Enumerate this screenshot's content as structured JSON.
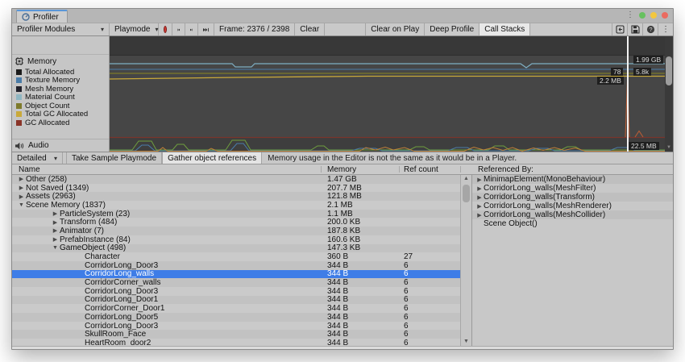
{
  "tab": {
    "title": "Profiler"
  },
  "window_controls": {
    "colors": [
      "#67c15f",
      "#f3c73f",
      "#ea6b60"
    ]
  },
  "toolbar": {
    "modules_dropdown": "Profiler Modules",
    "playmode_dropdown": "Playmode",
    "frame_label": "Frame: 2376 / 2398",
    "clear": "Clear",
    "clear_on_play": "Clear on Play",
    "deep_profile": "Deep Profile",
    "call_stacks": "Call Stacks"
  },
  "sidebar": {
    "memory_module": {
      "label": "Memory",
      "legend": [
        {
          "label": "Total Allocated",
          "color": "#1b1b1b"
        },
        {
          "label": "Texture Memory",
          "color": "#4a7ca8"
        },
        {
          "label": "Mesh Memory",
          "color": "#20202a"
        },
        {
          "label": "Material Count",
          "color": "#8fb6c2"
        },
        {
          "label": "Object Count",
          "color": "#7e7a2b"
        },
        {
          "label": "Total GC Allocated",
          "color": "#c9a93a"
        },
        {
          "label": "GC Allocated",
          "color": "#8a3428"
        }
      ]
    },
    "audio_module": {
      "label": "Audio"
    }
  },
  "chart": {
    "labels": {
      "total_allocated": "1.99 GB",
      "object_count": "78",
      "material_count": "5.8k",
      "gc_allocated": "2.2 MB",
      "audio_bottom": "22.5 MB"
    },
    "line_colors": {
      "material": "#7eafc4",
      "texture": "#4a7ca8",
      "object": "#7e7a2b",
      "total_gc": "#c9a93a",
      "gc": "#7a352c",
      "gc_spike": "#b85c35",
      "audio_green": "#6f9f3f",
      "audio_blue": "#4a7ca8",
      "audio_orange": "#c08038"
    }
  },
  "detail_toolbar": {
    "detailed_dropdown": "Detailed",
    "take_sample": "Take Sample Playmode",
    "gather_refs": "Gather object references",
    "info": "Memory usage in the Editor is not the same as it would be in a Player."
  },
  "table": {
    "columns": {
      "name": "Name",
      "memory": "Memory",
      "ref_count": "Ref count"
    },
    "rows": [
      {
        "name": "Other (258)",
        "level": 0,
        "arrow": "collapsed",
        "memory": "1.47 GB",
        "ref": ""
      },
      {
        "name": "Not Saved (1349)",
        "level": 0,
        "arrow": "collapsed",
        "memory": "207.7 MB",
        "ref": ""
      },
      {
        "name": "Assets (2963)",
        "level": 0,
        "arrow": "collapsed",
        "memory": "121.8 MB",
        "ref": ""
      },
      {
        "name": "Scene Memory (1837)",
        "level": 0,
        "arrow": "expanded",
        "memory": "2.1 MB",
        "ref": ""
      },
      {
        "name": "ParticleSystem (23)",
        "level": 1,
        "arrow": "collapsed",
        "memory": "1.1 MB",
        "ref": ""
      },
      {
        "name": "Transform (484)",
        "level": 1,
        "arrow": "collapsed",
        "memory": "200.0 KB",
        "ref": ""
      },
      {
        "name": "Animator (7)",
        "level": 1,
        "arrow": "collapsed",
        "memory": "187.8 KB",
        "ref": ""
      },
      {
        "name": "PrefabInstance (84)",
        "level": 1,
        "arrow": "collapsed",
        "memory": "160.6 KB",
        "ref": ""
      },
      {
        "name": "GameObject (498)",
        "level": 1,
        "arrow": "expanded",
        "memory": "147.3 KB",
        "ref": ""
      },
      {
        "name": "Character",
        "level": 2,
        "arrow": "none",
        "memory": "360 B",
        "ref": "27"
      },
      {
        "name": "CorridorLong_Door3",
        "level": 2,
        "arrow": "none",
        "memory": "344 B",
        "ref": "6"
      },
      {
        "name": "CorridorLong_walls",
        "level": 2,
        "arrow": "none",
        "memory": "344 B",
        "ref": "6",
        "selected": true
      },
      {
        "name": "CorridorCorner_walls",
        "level": 2,
        "arrow": "none",
        "memory": "344 B",
        "ref": "6"
      },
      {
        "name": "CorridorLong_Door3",
        "level": 2,
        "arrow": "none",
        "memory": "344 B",
        "ref": "6"
      },
      {
        "name": "CorridorLong_Door1",
        "level": 2,
        "arrow": "none",
        "memory": "344 B",
        "ref": "6"
      },
      {
        "name": "CorridorCorner_Door1",
        "level": 2,
        "arrow": "none",
        "memory": "344 B",
        "ref": "6"
      },
      {
        "name": "CorridorLong_Door5",
        "level": 2,
        "arrow": "none",
        "memory": "344 B",
        "ref": "6"
      },
      {
        "name": "CorridorLong_Door3",
        "level": 2,
        "arrow": "none",
        "memory": "344 B",
        "ref": "6"
      },
      {
        "name": "SkullRoom_Face",
        "level": 2,
        "arrow": "none",
        "memory": "344 B",
        "ref": "6"
      },
      {
        "name": "HeartRoom_door2",
        "level": 2,
        "arrow": "none",
        "memory": "344 B",
        "ref": "6"
      }
    ]
  },
  "referenced_by": {
    "header": "Referenced By:",
    "items": [
      {
        "label": "MinimapElement(MonoBehaviour)",
        "arrow": "collapsed"
      },
      {
        "label": "CorridorLong_walls(MeshFilter)",
        "arrow": "collapsed"
      },
      {
        "label": "CorridorLong_walls(Transform)",
        "arrow": "collapsed"
      },
      {
        "label": "CorridorLong_walls(MeshRenderer)",
        "arrow": "collapsed"
      },
      {
        "label": "CorridorLong_walls(MeshCollider)",
        "arrow": "collapsed"
      },
      {
        "label": "Scene Object()",
        "arrow": "none"
      }
    ]
  }
}
